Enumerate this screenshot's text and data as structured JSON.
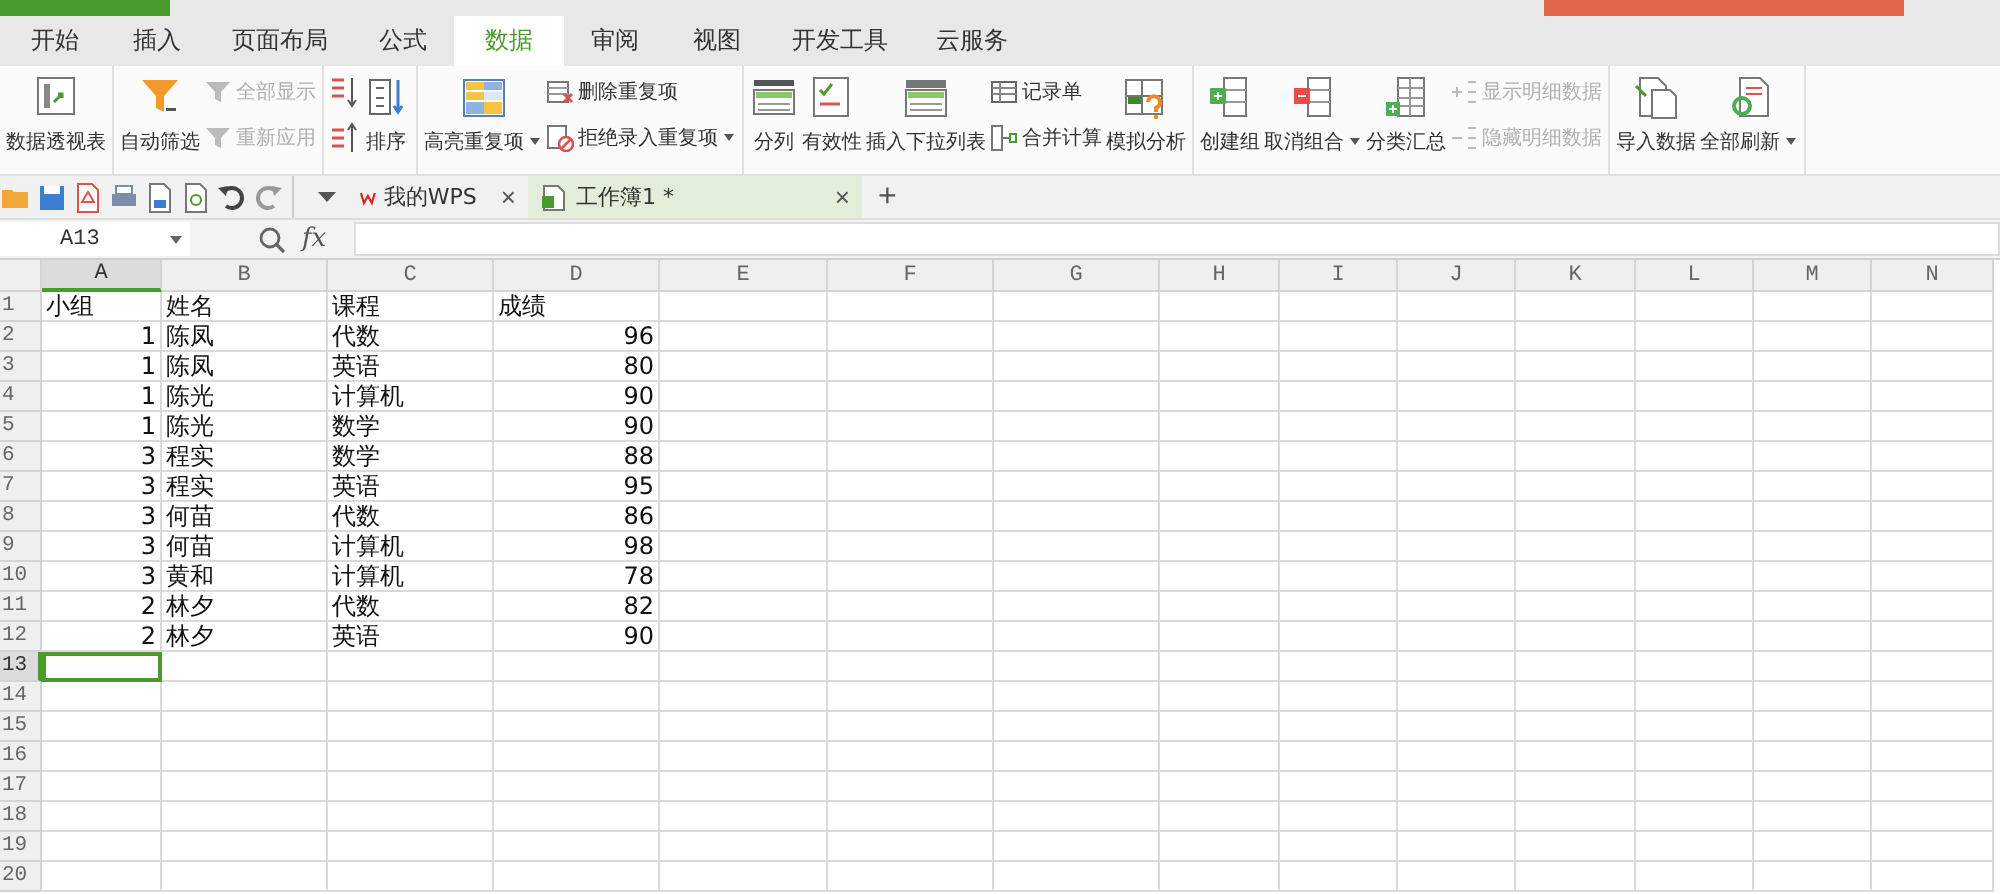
{
  "menu_tabs": [
    {
      "label": "开始",
      "selected": false
    },
    {
      "label": "插入",
      "selected": false
    },
    {
      "label": "页面布局",
      "selected": false
    },
    {
      "label": "公式",
      "selected": false
    },
    {
      "label": "数据",
      "selected": true
    },
    {
      "label": "审阅",
      "selected": false
    },
    {
      "label": "视图",
      "selected": false
    },
    {
      "label": "开发工具",
      "selected": false
    },
    {
      "label": "云服务",
      "selected": false
    }
  ],
  "ribbon": [
    [
      {
        "kind": "large",
        "label": "数据透视表",
        "dropdown": false
      }
    ],
    [
      {
        "kind": "large",
        "label": "自动筛选",
        "dropdown": false
      },
      {
        "kind": "stack",
        "items": [
          {
            "label": "全部显示",
            "disabled": true,
            "dropdown": false
          },
          {
            "label": "重新应用",
            "disabled": true,
            "dropdown": false
          }
        ]
      }
    ],
    [
      {
        "kind": "sort_icons"
      },
      {
        "kind": "large",
        "label": "排序",
        "dropdown": false
      }
    ],
    [
      {
        "kind": "large",
        "label": "高亮重复项",
        "dropdown": true
      },
      {
        "kind": "stack",
        "items": [
          {
            "label": "删除重复项",
            "disabled": false,
            "dropdown": false
          },
          {
            "label": "拒绝录入重复项",
            "disabled": false,
            "dropdown": true
          }
        ]
      }
    ],
    [
      {
        "kind": "large",
        "label": "分列",
        "dropdown": false
      },
      {
        "kind": "large",
        "label": "有效性",
        "dropdown": false
      },
      {
        "kind": "large",
        "label": "插入下拉列表",
        "dropdown": false
      },
      {
        "kind": "stack",
        "items": [
          {
            "label": "记录单",
            "disabled": false,
            "dropdown": false
          },
          {
            "label": "合并计算",
            "disabled": false,
            "dropdown": false
          }
        ]
      },
      {
        "kind": "large",
        "label": "模拟分析",
        "dropdown": false
      }
    ],
    [
      {
        "kind": "large",
        "label": "创建组",
        "dropdown": false
      },
      {
        "kind": "large",
        "label": "取消组合",
        "dropdown": true
      },
      {
        "kind": "large",
        "label": "分类汇总",
        "dropdown": false
      },
      {
        "kind": "stack",
        "items": [
          {
            "label": "显示明细数据",
            "disabled": true,
            "dropdown": false
          },
          {
            "label": "隐藏明细数据",
            "disabled": true,
            "dropdown": false
          }
        ]
      }
    ],
    [
      {
        "kind": "large",
        "label": "导入数据",
        "dropdown": false
      },
      {
        "kind": "large",
        "label": "全部刷新",
        "dropdown": true
      }
    ]
  ],
  "doc_tabs": [
    {
      "label": "我的WPS",
      "selected": false
    },
    {
      "label": "工作簿1 *",
      "selected": true
    }
  ],
  "doc_tab_close": "×",
  "new_tab": "+",
  "formula_bar": {
    "name_box": "A13",
    "fx": "fx"
  },
  "sheet": {
    "columns": [
      {
        "label": "A",
        "selected": true
      },
      {
        "label": "B",
        "selected": false
      },
      {
        "label": "C",
        "selected": false
      },
      {
        "label": "D",
        "selected": false
      },
      {
        "label": "E",
        "selected": false
      },
      {
        "label": "F",
        "selected": false
      },
      {
        "label": "G",
        "selected": false
      },
      {
        "label": "H",
        "selected": false
      },
      {
        "label": "I",
        "selected": false
      },
      {
        "label": "J",
        "selected": false
      },
      {
        "label": "K",
        "selected": false
      },
      {
        "label": "L",
        "selected": false
      },
      {
        "label": "M",
        "selected": false
      },
      {
        "label": "N",
        "selected": false
      }
    ],
    "rows": [
      {
        "number": "1",
        "selected": false,
        "cells": [
          {
            "value": "小组",
            "kind": "text"
          },
          {
            "value": "姓名",
            "kind": "text"
          },
          {
            "value": "课程",
            "kind": "text"
          },
          {
            "value": "成绩",
            "kind": "text"
          }
        ]
      },
      {
        "number": "2",
        "selected": false,
        "cells": [
          {
            "value": "1",
            "kind": "number"
          },
          {
            "value": "陈凤",
            "kind": "text"
          },
          {
            "value": "代数",
            "kind": "text"
          },
          {
            "value": "96",
            "kind": "number"
          }
        ]
      },
      {
        "number": "3",
        "selected": false,
        "cells": [
          {
            "value": "1",
            "kind": "number"
          },
          {
            "value": "陈凤",
            "kind": "text"
          },
          {
            "value": "英语",
            "kind": "text"
          },
          {
            "value": "80",
            "kind": "number"
          }
        ]
      },
      {
        "number": "4",
        "selected": false,
        "cells": [
          {
            "value": "1",
            "kind": "number"
          },
          {
            "value": "陈光",
            "kind": "text"
          },
          {
            "value": "计算机",
            "kind": "text"
          },
          {
            "value": "90",
            "kind": "number"
          }
        ]
      },
      {
        "number": "5",
        "selected": false,
        "cells": [
          {
            "value": "1",
            "kind": "number"
          },
          {
            "value": "陈光",
            "kind": "text"
          },
          {
            "value": "数学",
            "kind": "text"
          },
          {
            "value": "90",
            "kind": "number"
          }
        ]
      },
      {
        "number": "6",
        "selected": false,
        "cells": [
          {
            "value": "3",
            "kind": "number"
          },
          {
            "value": "程实",
            "kind": "text"
          },
          {
            "value": "数学",
            "kind": "text"
          },
          {
            "value": "88",
            "kind": "number"
          }
        ]
      },
      {
        "number": "7",
        "selected": false,
        "cells": [
          {
            "value": "3",
            "kind": "number"
          },
          {
            "value": "程实",
            "kind": "text"
          },
          {
            "value": "英语",
            "kind": "text"
          },
          {
            "value": "95",
            "kind": "number"
          }
        ]
      },
      {
        "number": "8",
        "selected": false,
        "cells": [
          {
            "value": "3",
            "kind": "number"
          },
          {
            "value": "何苗",
            "kind": "text"
          },
          {
            "value": "代数",
            "kind": "text"
          },
          {
            "value": "86",
            "kind": "number"
          }
        ]
      },
      {
        "number": "9",
        "selected": false,
        "cells": [
          {
            "value": "3",
            "kind": "number"
          },
          {
            "value": "何苗",
            "kind": "text"
          },
          {
            "value": "计算机",
            "kind": "text"
          },
          {
            "value": "98",
            "kind": "number"
          }
        ]
      },
      {
        "number": "10",
        "selected": false,
        "cells": [
          {
            "value": "3",
            "kind": "number"
          },
          {
            "value": "黄和",
            "kind": "text"
          },
          {
            "value": "计算机",
            "kind": "text"
          },
          {
            "value": "78",
            "kind": "number"
          }
        ]
      },
      {
        "number": "11",
        "selected": false,
        "cells": [
          {
            "value": "2",
            "kind": "number"
          },
          {
            "value": "林夕",
            "kind": "text"
          },
          {
            "value": "代数",
            "kind": "text"
          },
          {
            "value": "82",
            "kind": "number"
          }
        ]
      },
      {
        "number": "12",
        "selected": false,
        "cells": [
          {
            "value": "2",
            "kind": "number"
          },
          {
            "value": "林夕",
            "kind": "text"
          },
          {
            "value": "英语",
            "kind": "text"
          },
          {
            "value": "90",
            "kind": "number"
          }
        ]
      },
      {
        "number": "13",
        "selected": true,
        "cells": []
      },
      {
        "number": "14",
        "selected": false,
        "cells": []
      },
      {
        "number": "15",
        "selected": false,
        "cells": []
      },
      {
        "number": "16",
        "selected": false,
        "cells": []
      },
      {
        "number": "17",
        "selected": false,
        "cells": []
      },
      {
        "number": "18",
        "selected": false,
        "cells": []
      },
      {
        "number": "19",
        "selected": false,
        "cells": []
      },
      {
        "number": "20",
        "selected": false,
        "cells": []
      }
    ]
  }
}
